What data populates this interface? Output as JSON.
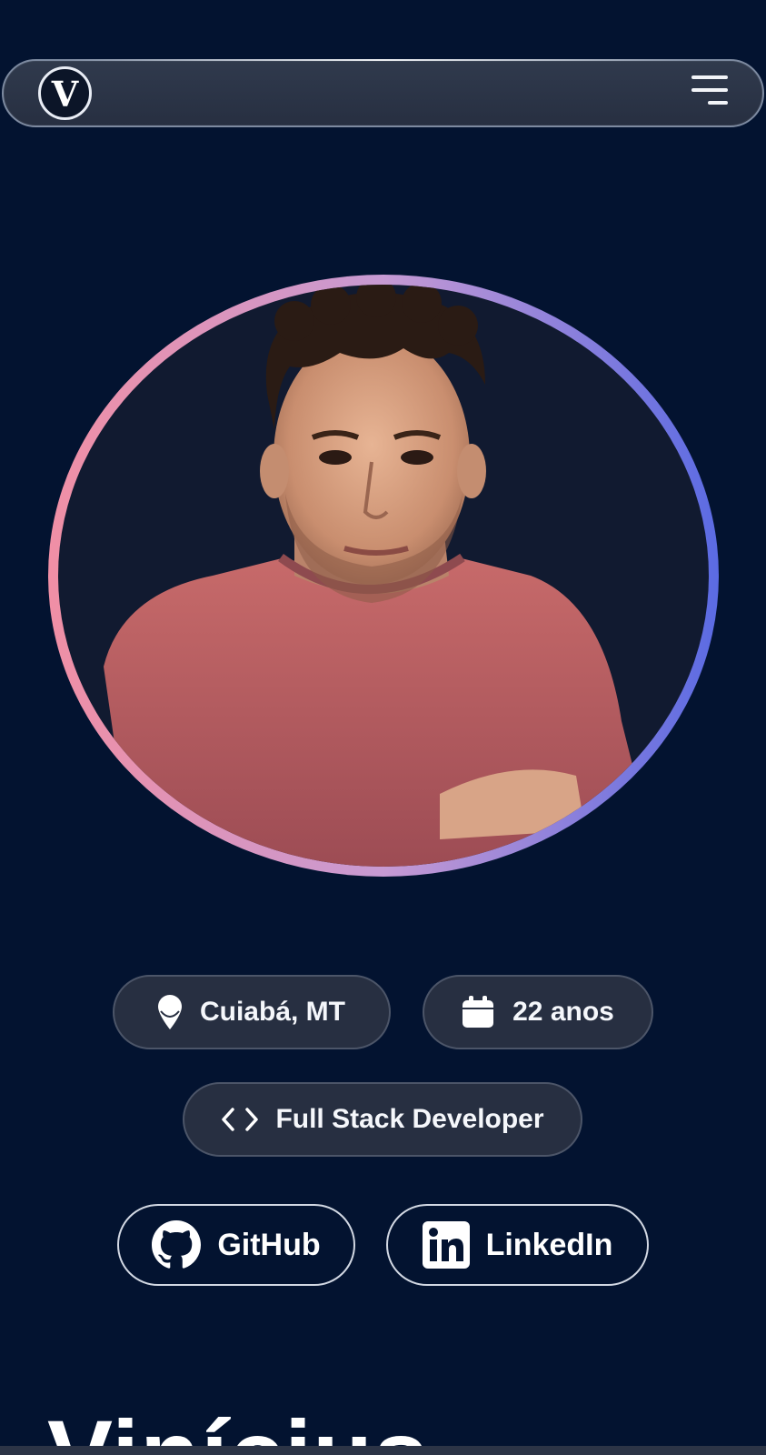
{
  "navbar": {
    "logo_letter": "V",
    "menu_icon": "hamburger-menu-icon"
  },
  "avatar": {
    "description_icon": "profile-photo",
    "ring_colors": [
      "#f08fa5",
      "#c79ad3",
      "#5b6be3"
    ]
  },
  "info": {
    "location": {
      "icon": "map-pin-icon",
      "text": "Cuiabá, MT"
    },
    "age": {
      "icon": "calendar-icon",
      "text": "22 anos"
    },
    "role": {
      "icon": "code-brackets-icon",
      "text": "Full Stack Developer"
    }
  },
  "social": {
    "github": {
      "icon": "github-icon",
      "label": "GitHub"
    },
    "linkedin": {
      "icon": "linkedin-icon",
      "label": "LinkedIn"
    }
  },
  "hero": {
    "name": "Vinícius"
  },
  "colors": {
    "background": "#031330",
    "chip_bg": "#272f41",
    "text": "#ffffff"
  }
}
